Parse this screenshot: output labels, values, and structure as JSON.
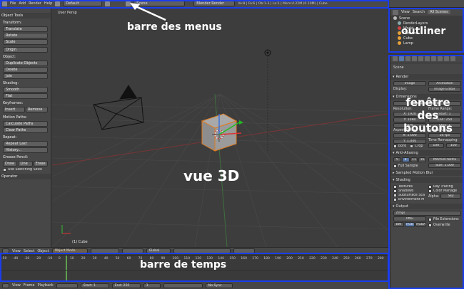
{
  "topbar": {
    "menus": [
      "File",
      "Add",
      "Render",
      "Help"
    ],
    "layout": "Default",
    "scene": "Scene",
    "engine": "Blender Render",
    "info": "Ve:8 | Fa:6 | Ob:1-3 | La:1 | Mem:4.22M (0.10M) | Cube"
  },
  "tools": {
    "header": "Object Tools",
    "transform_label": "Transform:",
    "transform": [
      "Translate",
      "Rotate",
      "Scale"
    ],
    "origin": "Origin",
    "object_label": "Object:",
    "object": [
      "Duplicate Objects",
      "Delete",
      "Join"
    ],
    "shading_label": "Shading:",
    "shading": [
      "Smooth",
      "Flat"
    ],
    "keyframes_label": "Keyframes:",
    "keyframes": [
      "Insert",
      "Remove"
    ],
    "motion_label": "Motion Paths:",
    "motion": [
      "Calculate Paths",
      "Clear Paths"
    ],
    "repeat_label": "Repeat:",
    "repeat": [
      "Repeat Last",
      "History..."
    ],
    "grease_label": "Grease Pencil:",
    "grease": [
      "Draw",
      "Line",
      "Erase"
    ],
    "sketch": "Use Sketching Sessi",
    "operator": "Operator"
  },
  "view": {
    "label": "User Persp",
    "object_name": "(1) Cube"
  },
  "viewhdr": {
    "menus": [
      "View",
      "Select",
      "Object"
    ],
    "mode": "Object Mode",
    "orient": "Global"
  },
  "timeline": {
    "ticks": [
      "-50",
      "-40",
      "-30",
      "-20",
      "-10",
      "0",
      "10",
      "20",
      "30",
      "40",
      "50",
      "60",
      "70",
      "80",
      "90",
      "100",
      "110",
      "120",
      "130",
      "140",
      "150",
      "160",
      "170",
      "180",
      "190",
      "200",
      "210",
      "220",
      "230",
      "240",
      "250",
      "260",
      "270",
      "280"
    ],
    "current_frame": 1
  },
  "tlhdr": {
    "menus": [
      "View",
      "Frame",
      "Playback"
    ],
    "start": "Start: 1",
    "end": "End: 250",
    "frame": "1",
    "sync": "No Sync"
  },
  "outliner": {
    "menus": [
      "View",
      "Search",
      "All Scenes"
    ],
    "items": [
      "Scene",
      "RenderLayers",
      "World",
      "Camera",
      "Cube",
      "Lamp"
    ]
  },
  "props": {
    "scene": "Scene",
    "render_hdr": "Render",
    "image_btn": "Image",
    "animation_btn": "Animation",
    "display_label": "Display:",
    "display_val": "Image Editor",
    "dimensions_hdr": "Dimensions",
    "presets": "Render Presets",
    "resolution_label": "Resolution:",
    "res_x": "X: 1920",
    "res_y": "Y: 1080",
    "res_pct": "50%",
    "frame_range_label": "Frame Range:",
    "start": "Start: 1",
    "end": "End: 250",
    "step": "Step: 1",
    "aspect_label": "Aspect Ratio:",
    "asp_x": "X: 1.000",
    "asp_y": "Y: 1.000",
    "frame_rate_label": "Frame Rate:",
    "fps": "24 fps",
    "remap_label": "Time Remapping:",
    "remap_old": "100",
    "remap_new": "100",
    "border": "Bord",
    "crop": "Crop",
    "aa_hdr": "Anti-Aliasing",
    "aa_samples": [
      "5",
      "8",
      "11",
      "16"
    ],
    "aa_filter": "Mitchell-Netra",
    "full_sample": "Full Sample",
    "size": "Size: 1.000",
    "motion_blur_hdr": "Sampled Motion Blur",
    "shading_hdr": "Shading",
    "textures": "Textures",
    "ray": "Ray Tracing",
    "shadows": "Shadows",
    "color": "Color Manage",
    "sss": "Subsurface Sca",
    "alpha_label": "Alpha:",
    "alpha": "Sky",
    "env": "Environment M",
    "output_hdr": "Output",
    "path": "/tmp\\",
    "format": "PNG",
    "file_ext": "File Extensions",
    "overwrite": "Overwrite",
    "bw": "BW",
    "rgb": "RGB",
    "rgba": "RGBA"
  },
  "callouts": {
    "menus": "barre des menus",
    "outliner": "outliner",
    "buttons": "fenêtre des boutons",
    "view3d": "vue 3D",
    "timeline": "barre de temps"
  }
}
